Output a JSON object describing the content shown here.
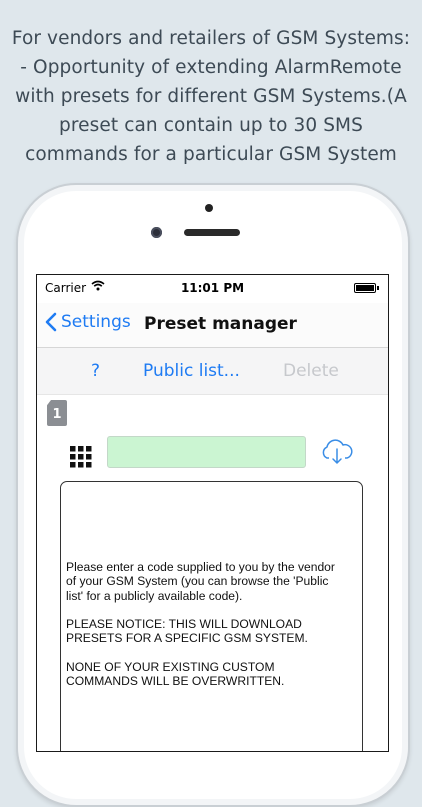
{
  "caption": {
    "lines": [
      "For vendors and retailers of GSM Systems:",
      "- Opportunity of extending AlarmRemote",
      "with presets for different GSM Systems.(A",
      "preset can contain up to 30 SMS",
      "commands for a particular GSM System"
    ]
  },
  "status_bar": {
    "carrier": "Carrier",
    "time": "11:01 PM",
    "icons": [
      "wifi-icon",
      "battery-icon"
    ]
  },
  "nav_bar": {
    "back_label": "Settings",
    "title": "Preset manager"
  },
  "toolbar": {
    "help_label": "?",
    "public_list_label": "Public list...",
    "delete_label": "Delete",
    "delete_disabled": true
  },
  "sim_badge": {
    "number": "1"
  },
  "code_input": {
    "value": "",
    "placeholder": ""
  },
  "info": {
    "lines_1": [
      "Please enter a code supplied to you by the vendor",
      "of your GSM System (you can browse the 'Public",
      "list' for a publicly available code)."
    ],
    "lines_2": [
      "PLEASE NOTICE: THIS WILL DOWNLOAD",
      "PRESETS FOR A SPECIFIC GSM SYSTEM."
    ],
    "lines_3": [
      "NONE OF YOUR EXISTING CUSTOM",
      "COMMANDS WILL BE OVERWRITTEN."
    ]
  },
  "colors": {
    "accent": "#1e7bf3",
    "disabled": "#c6c8cc",
    "code_field": "#cbf5d2",
    "background": "#dfe7ec"
  }
}
